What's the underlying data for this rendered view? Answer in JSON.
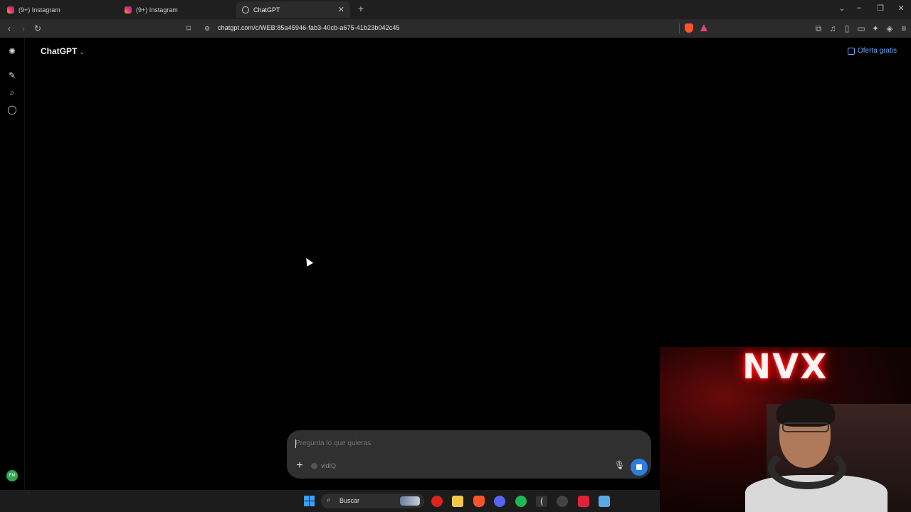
{
  "browser": {
    "tabs": [
      {
        "title": "(9+) Instagram",
        "icon": "instagram-icon",
        "active": false
      },
      {
        "title": "(9+) Instagram",
        "icon": "instagram-icon",
        "active": false
      },
      {
        "title": "ChatGPT",
        "icon": "chatgpt-icon",
        "active": true
      }
    ],
    "url": "chatgpt.com/c/WEB:85a45946-fab3-40cb-a675-41b23b042c45"
  },
  "page": {
    "model_label": "ChatGPT",
    "offer_label": "Oferta gratis",
    "avatar_initials": "FM",
    "composer": {
      "placeholder": "Pregunta lo que quieras",
      "extension_label": "vidIQ"
    }
  },
  "webcam": {
    "neon_text": "NVX"
  },
  "taskbar": {
    "search_label": "Buscar"
  },
  "colors": {
    "accent_blue": "#2a7de1",
    "link_blue": "#66a8ff",
    "page_bg": "#000000",
    "composer_bg": "#303030"
  }
}
